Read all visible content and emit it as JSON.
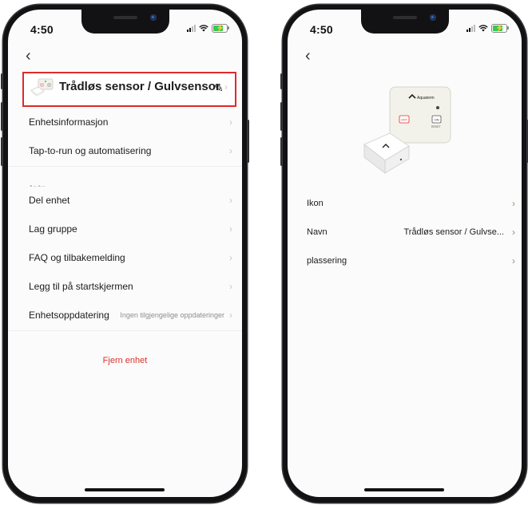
{
  "status_bar": {
    "time_left": "4:50",
    "time_right": "4:50"
  },
  "left_screen": {
    "device_name": "Trådløs sensor / Gulvsensor",
    "rows_top": [
      {
        "label": "Enhetsinformasjon"
      },
      {
        "label": "Tap-to-run og automatisering"
      }
    ],
    "section_label": "Andre",
    "rows_other": [
      {
        "label": "Del enhet"
      },
      {
        "label": "Lag gruppe"
      },
      {
        "label": "FAQ og tilbakemelding"
      },
      {
        "label": "Legg til på startskjermen"
      },
      {
        "label": "Enhetsoppdatering",
        "value": "Ingen tilgjengelige oppdateringer"
      }
    ],
    "remove_label": "Fjern enhet"
  },
  "right_screen": {
    "product_brand": "Aquaterm",
    "product_buttons": {
      "off": "OFF",
      "on": "ON",
      "reset": "RESET"
    },
    "rows": [
      {
        "label": "Ikon",
        "value": ""
      },
      {
        "label": "Navn",
        "value": "Trådløs sensor / Gulvse..."
      },
      {
        "label": "plassering",
        "value": ""
      }
    ]
  },
  "colors": {
    "highlight_border": "#e02a2a",
    "danger_text": "#d9342b",
    "battery": "#34c759"
  },
  "icons": [
    "back-chevron-icon",
    "pencil-icon",
    "chevron-right-icon",
    "wifi-icon",
    "cellular-icon",
    "battery-charging-icon"
  ]
}
